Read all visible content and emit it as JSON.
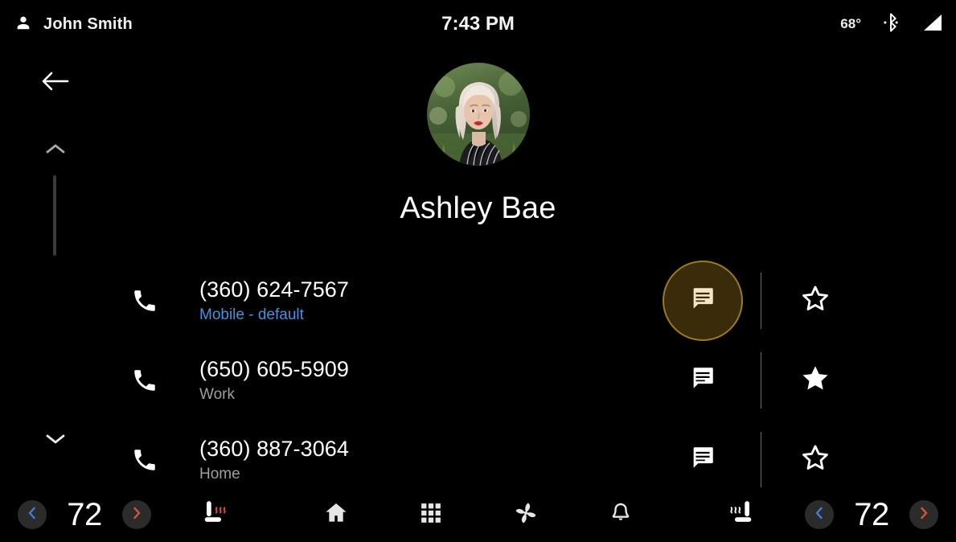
{
  "status_bar": {
    "user_name": "John Smith",
    "user_icon": "person-icon",
    "time": "7:43 PM",
    "temperature": "68°",
    "bluetooth_icon": "bluetooth-icon",
    "signal_icon": "signal-bars-icon"
  },
  "navigation": {
    "back_icon": "arrow-left-icon",
    "scroll_up_icon": "chevron-up-icon",
    "scroll_down_icon": "chevron-down-icon"
  },
  "contact": {
    "name": "Ashley Bae",
    "avatar_icon": "contact-photo"
  },
  "numbers": [
    {
      "number": "(360) 624-7567",
      "label": "Mobile - default",
      "is_default": true,
      "call_icon": "phone-icon",
      "message_icon": "message-icon",
      "message_focused": true,
      "star_icon": "star-outline-icon",
      "favorited": false
    },
    {
      "number": "(650) 605-5909",
      "label": "Work",
      "is_default": false,
      "call_icon": "phone-icon",
      "message_icon": "message-icon",
      "message_focused": false,
      "star_icon": "star-filled-icon",
      "favorited": true
    },
    {
      "number": "(360) 887-3064",
      "label": "Home",
      "is_default": false,
      "call_icon": "phone-icon",
      "message_icon": "message-icon",
      "message_focused": false,
      "star_icon": "star-outline-icon",
      "favorited": false
    }
  ],
  "bottom_bar": {
    "left_climate": {
      "decrease_icon": "chevron-left-icon",
      "temperature": "72",
      "increase_icon": "chevron-right-icon"
    },
    "right_climate": {
      "decrease_icon": "chevron-left-icon",
      "temperature": "72",
      "increase_icon": "chevron-right-icon"
    },
    "left_seat_icon": "heated-seat-icon",
    "right_seat_icon": "ventilated-seat-icon",
    "nav_items": [
      {
        "icon": "home-icon",
        "name": "home"
      },
      {
        "icon": "apps-grid-icon",
        "name": "apps"
      },
      {
        "icon": "fan-icon",
        "name": "climate"
      },
      {
        "icon": "bell-icon",
        "name": "notifications"
      }
    ]
  },
  "colors": {
    "background": "#000000",
    "text_primary": "#ffffff",
    "text_secondary": "#9e9e9e",
    "accent_blue": "#4a90e2",
    "focus_fill": "#3a2c0b",
    "focus_border": "#9a7b1f",
    "focus_icon": "#f5e6c8",
    "chevron_cold": "#3f7fd4",
    "chevron_hot": "#d9543a"
  }
}
